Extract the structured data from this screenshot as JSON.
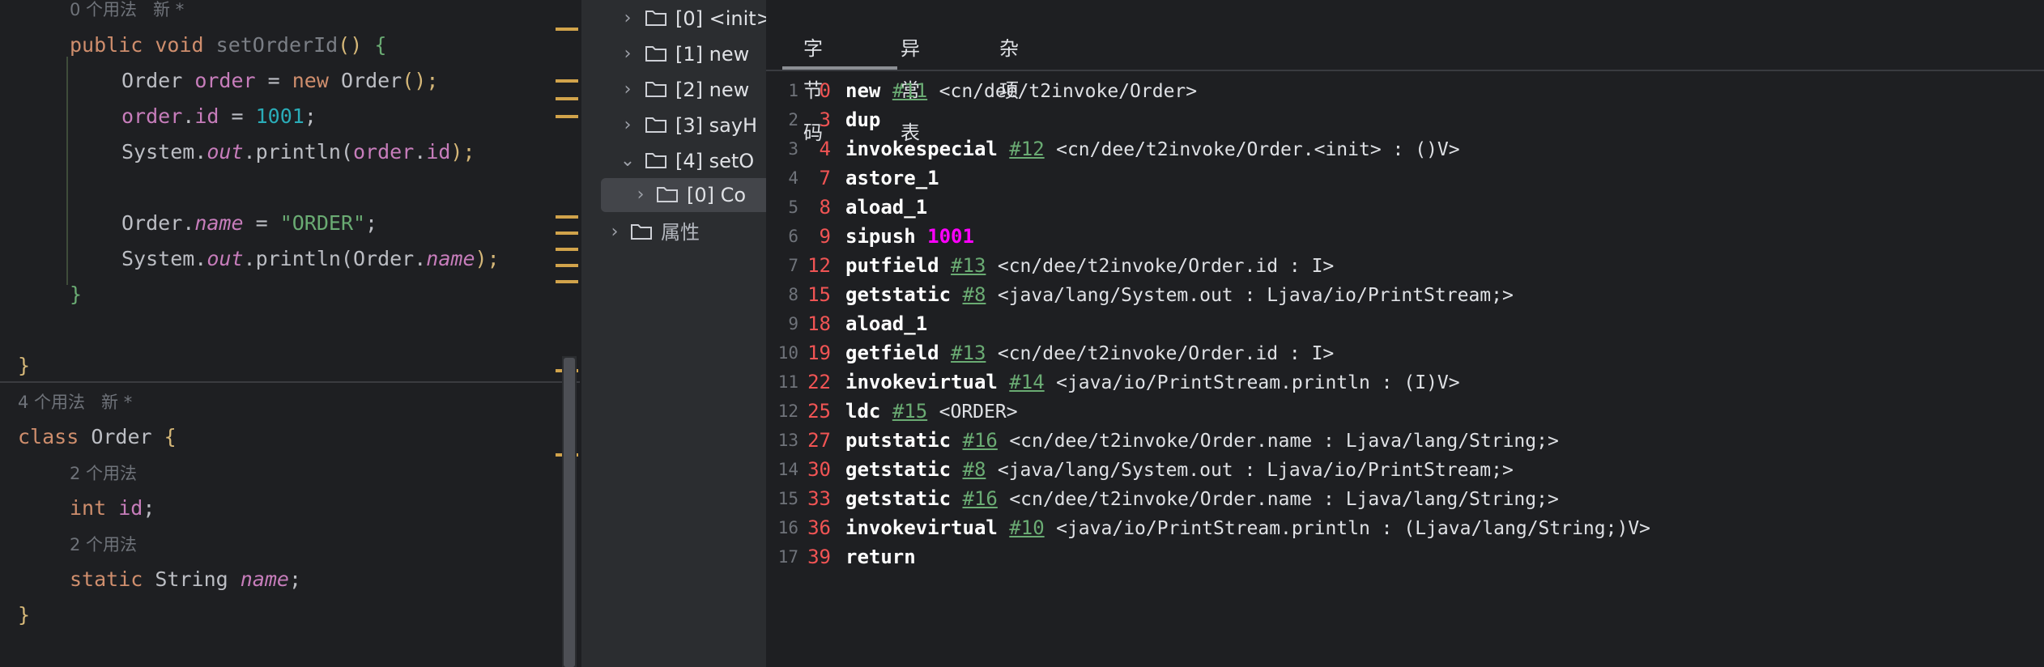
{
  "editor": {
    "hint_top": "0 个用法   新 *",
    "method_sig": {
      "public": "public",
      "void": "void",
      "name": "setOrderId",
      "parens": "()",
      "brace": "{"
    },
    "line_new": {
      "type": "Order",
      "var": "order",
      "eq": " = ",
      "new": "new",
      "ctor": "Order",
      "end": "();"
    },
    "line_assign": {
      "obj": "order",
      "dot": ".",
      "field": "id",
      "eq": " = ",
      "val": "1001",
      "end": ";"
    },
    "line_print1": {
      "pre": "System.",
      "out": "out",
      "mid": ".println(",
      "obj": "order",
      "dot": ".",
      "field": "id",
      "end": ");"
    },
    "line_static": {
      "cls": "Order.",
      "field": "name",
      "eq": " = ",
      "val": "\"ORDER\"",
      "end": ";"
    },
    "line_print2": {
      "pre": "System.",
      "out": "out",
      "mid": ".println(Order.",
      "field": "name",
      "end": ");"
    },
    "close_method": "}",
    "close_class_outer": "}",
    "hint_class": "4 个用法   新 *",
    "class_decl": {
      "kw": "class",
      "name": "Order",
      "brace": "{"
    },
    "hint_id": "2 个用法",
    "field_id": {
      "type": "int",
      "name": "id",
      "end": ";"
    },
    "hint_name": "2 个用法",
    "field_name": {
      "kw": "static",
      "type": "String",
      "name": "name",
      "end": ";"
    },
    "close_class": "}"
  },
  "tree": {
    "items": [
      {
        "label": "[0] <init>",
        "chevron": "›"
      },
      {
        "label": "[1] new",
        "chevron": "›"
      },
      {
        "label": "[2] new",
        "chevron": "›"
      },
      {
        "label": "[3] sayH",
        "chevron": "›"
      },
      {
        "label": "[4] setO",
        "chevron": "⌄"
      },
      {
        "label": "[0] Co",
        "chevron": "›"
      },
      {
        "label": "属性",
        "chevron": "›"
      }
    ]
  },
  "tabs": [
    {
      "label": "字节码",
      "active": true
    },
    {
      "label": "异常表",
      "active": false
    },
    {
      "label": "杂项",
      "active": false
    }
  ],
  "bytecode": [
    {
      "ln": "1",
      "off": "0",
      "op": "new",
      "arg": "#11",
      "cmt": "<cn/dee/t2invoke/Order>"
    },
    {
      "ln": "2",
      "off": "3",
      "op": "dup",
      "arg": "",
      "cmt": ""
    },
    {
      "ln": "3",
      "off": "4",
      "op": "invokespecial",
      "arg": "#12",
      "cmt": "<cn/dee/t2invoke/Order.<init> : ()V>"
    },
    {
      "ln": "4",
      "off": "7",
      "op": "astore_1",
      "arg": "",
      "cmt": ""
    },
    {
      "ln": "5",
      "off": "8",
      "op": "aload_1",
      "arg": "",
      "cmt": ""
    },
    {
      "ln": "6",
      "off": "9",
      "op": "sipush",
      "imm": "1001",
      "arg": "",
      "cmt": ""
    },
    {
      "ln": "7",
      "off": "12",
      "op": "putfield",
      "arg": "#13",
      "cmt": "<cn/dee/t2invoke/Order.id : I>"
    },
    {
      "ln": "8",
      "off": "15",
      "op": "getstatic",
      "arg": "#8",
      "cmt": "<java/lang/System.out : Ljava/io/PrintStream;>"
    },
    {
      "ln": "9",
      "off": "18",
      "op": "aload_1",
      "arg": "",
      "cmt": ""
    },
    {
      "ln": "10",
      "off": "19",
      "op": "getfield",
      "arg": "#13",
      "cmt": "<cn/dee/t2invoke/Order.id : I>"
    },
    {
      "ln": "11",
      "off": "22",
      "op": "invokevirtual",
      "arg": "#14",
      "cmt": "<java/io/PrintStream.println : (I)V>"
    },
    {
      "ln": "12",
      "off": "25",
      "op": "ldc",
      "arg": "#15",
      "cmt": "<ORDER>"
    },
    {
      "ln": "13",
      "off": "27",
      "op": "putstatic",
      "arg": "#16",
      "cmt": "<cn/dee/t2invoke/Order.name : Ljava/lang/String;>"
    },
    {
      "ln": "14",
      "off": "30",
      "op": "getstatic",
      "arg": "#8",
      "cmt": "<java/lang/System.out : Ljava/io/PrintStream;>"
    },
    {
      "ln": "15",
      "off": "33",
      "op": "getstatic",
      "arg": "#16",
      "cmt": "<cn/dee/t2invoke/Order.name : Ljava/lang/String;>"
    },
    {
      "ln": "16",
      "off": "36",
      "op": "invokevirtual",
      "arg": "#10",
      "cmt": "<java/io/PrintStream.println : (Ljava/lang/String;)V>"
    },
    {
      "ln": "17",
      "off": "39",
      "op": "return",
      "arg": "",
      "cmt": ""
    }
  ],
  "colors": {
    "offset": "#f05454",
    "opcode": "#ffffff",
    "cp_ref": "#6aab73",
    "immediate": "#ff00ff",
    "gutter_mark": "#d1a34b"
  }
}
